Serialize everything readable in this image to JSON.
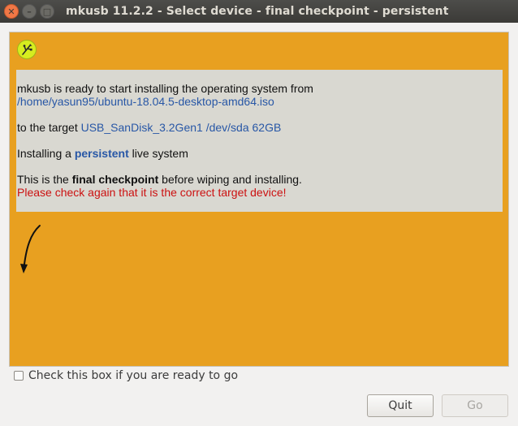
{
  "window": {
    "title": "mkusb 11.2.2 - Select device - final checkpoint - persistent",
    "close_glyph": "✕",
    "minimize_glyph": "–",
    "maximize_glyph": "□"
  },
  "panel": {
    "background": "#e8a020",
    "icon": "usb-icon",
    "line1": "mkusb is ready to start installing the operating system from",
    "iso_path": "/home/yasun95/ubuntu-18.04.5-desktop-amd64.iso",
    "target_prefix": "to the target ",
    "target_device": "USB_SanDisk_3.2Gen1 /dev/sda 62GB",
    "installing_prefix": "Installing a ",
    "installing_mode": "persistent",
    "installing_suffix": " live system",
    "checkpoint_prefix": "This is the ",
    "checkpoint_bold": "final checkpoint",
    "checkpoint_suffix": " before wiping and installing.",
    "warning": "Please check again that it is the correct target device!"
  },
  "confirm": {
    "label": "Check this box if you are ready to go",
    "checked": false
  },
  "buttons": {
    "quit": "Quit",
    "go": "Go"
  }
}
